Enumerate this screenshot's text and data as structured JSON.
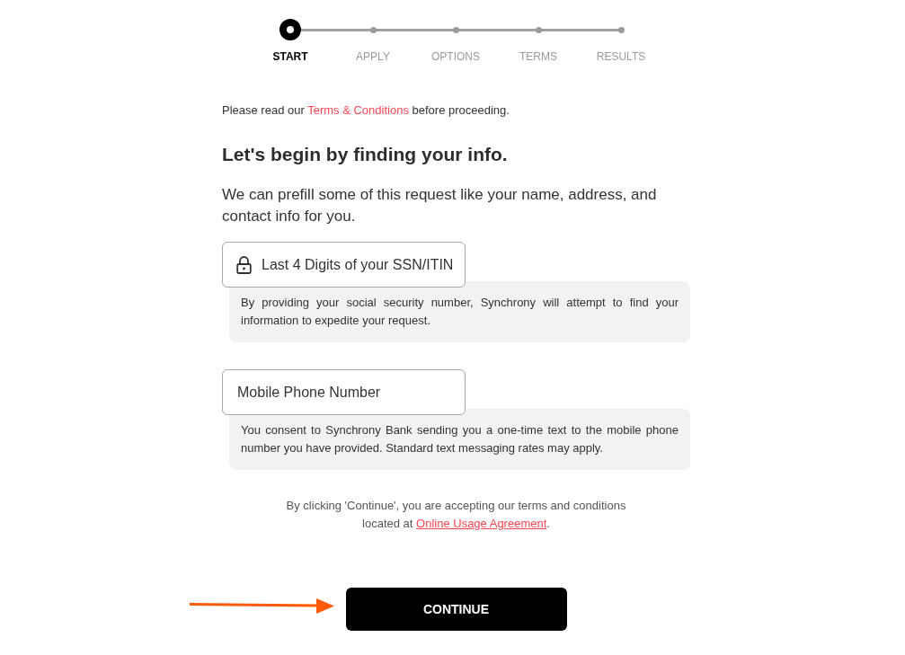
{
  "stepper": {
    "steps": [
      {
        "label": "START",
        "selected": true
      },
      {
        "label": "APPLY",
        "selected": false
      },
      {
        "label": "OPTIONS",
        "selected": false
      },
      {
        "label": "TERMS",
        "selected": false
      },
      {
        "label": "RESULTS",
        "selected": false
      }
    ]
  },
  "notice": {
    "before": "Please read our ",
    "link": "Terms & Conditions",
    "after": " before proceeding."
  },
  "heading": "Let's begin by finding your info.",
  "intro": "We can prefill some of this request like your name, address, and contact info for you.",
  "fields": [
    {
      "kind": "locked",
      "placeholder": "Last 4 Digits of your SSN/ITIN",
      "note": "By providing your social security number, Synchrony will attempt to find your information to expedite your request."
    },
    {
      "kind": "plain",
      "placeholder": "Mobile Phone Number",
      "note": "You consent to Synchrony Bank sending you a one-time text to the mobile phone number you have provided. Standard text messaging rates may apply."
    }
  ],
  "disclaimer": {
    "before": "By clicking 'Continue', you are accepting our terms and conditions located at ",
    "link": "Online Usage Agreement",
    "after": "."
  },
  "continue_button": "CONTINUE"
}
